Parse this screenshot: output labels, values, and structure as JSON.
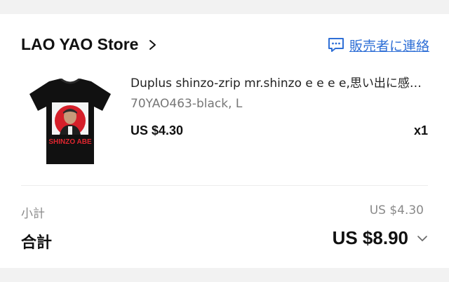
{
  "store": {
    "name": "LAO YAO Store",
    "contact_label": "販売者に連絡",
    "contact_icon": "chat-message-icon",
    "accent_color": "#2f6fd6"
  },
  "product": {
    "image_name": "tshirt-product-image",
    "image_text": "SHINZO ABE",
    "title": "Duplus shinzo-zrip mr.shinzo e e e e,思い出に感…",
    "variant": "70YAO463-black, L",
    "price": "US $4.30",
    "quantity": "x1"
  },
  "summary": {
    "subtotal_label": "小計",
    "subtotal_value": "US $4.30",
    "total_label": "合計",
    "total_value": "US $8.90"
  }
}
